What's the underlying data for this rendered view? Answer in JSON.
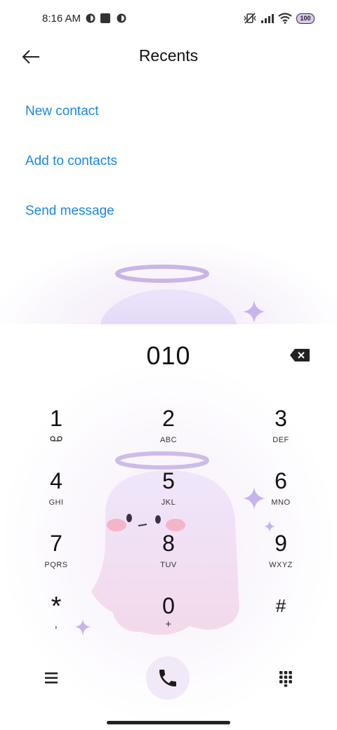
{
  "status_bar": {
    "time": "8:16 AM",
    "battery": "100"
  },
  "header": {
    "title": "Recents"
  },
  "actions": {
    "new_contact": "New contact",
    "add_to_contacts": "Add to contacts",
    "send_message": "Send message"
  },
  "dialer": {
    "number": "010",
    "keys": [
      {
        "digit": "1",
        "letters": ""
      },
      {
        "digit": "2",
        "letters": "ABC"
      },
      {
        "digit": "3",
        "letters": "DEF"
      },
      {
        "digit": "4",
        "letters": "GHI"
      },
      {
        "digit": "5",
        "letters": "JKL"
      },
      {
        "digit": "6",
        "letters": "MNO"
      },
      {
        "digit": "7",
        "letters": "PQRS"
      },
      {
        "digit": "8",
        "letters": "TUV"
      },
      {
        "digit": "9",
        "letters": "WXYZ"
      },
      {
        "digit": "*",
        "letters": ","
      },
      {
        "digit": "0",
        "letters": "+"
      },
      {
        "digit": "#",
        "letters": ""
      }
    ]
  },
  "icons": {
    "back": "arrow-left-icon",
    "backspace": "backspace-icon",
    "voicemail": "voicemail-icon",
    "menu": "menu-icon",
    "call": "phone-icon",
    "dialpad": "dialpad-icon"
  },
  "colors": {
    "accent": "#1a88e6",
    "call_button_bg": "#f1e9f7"
  }
}
